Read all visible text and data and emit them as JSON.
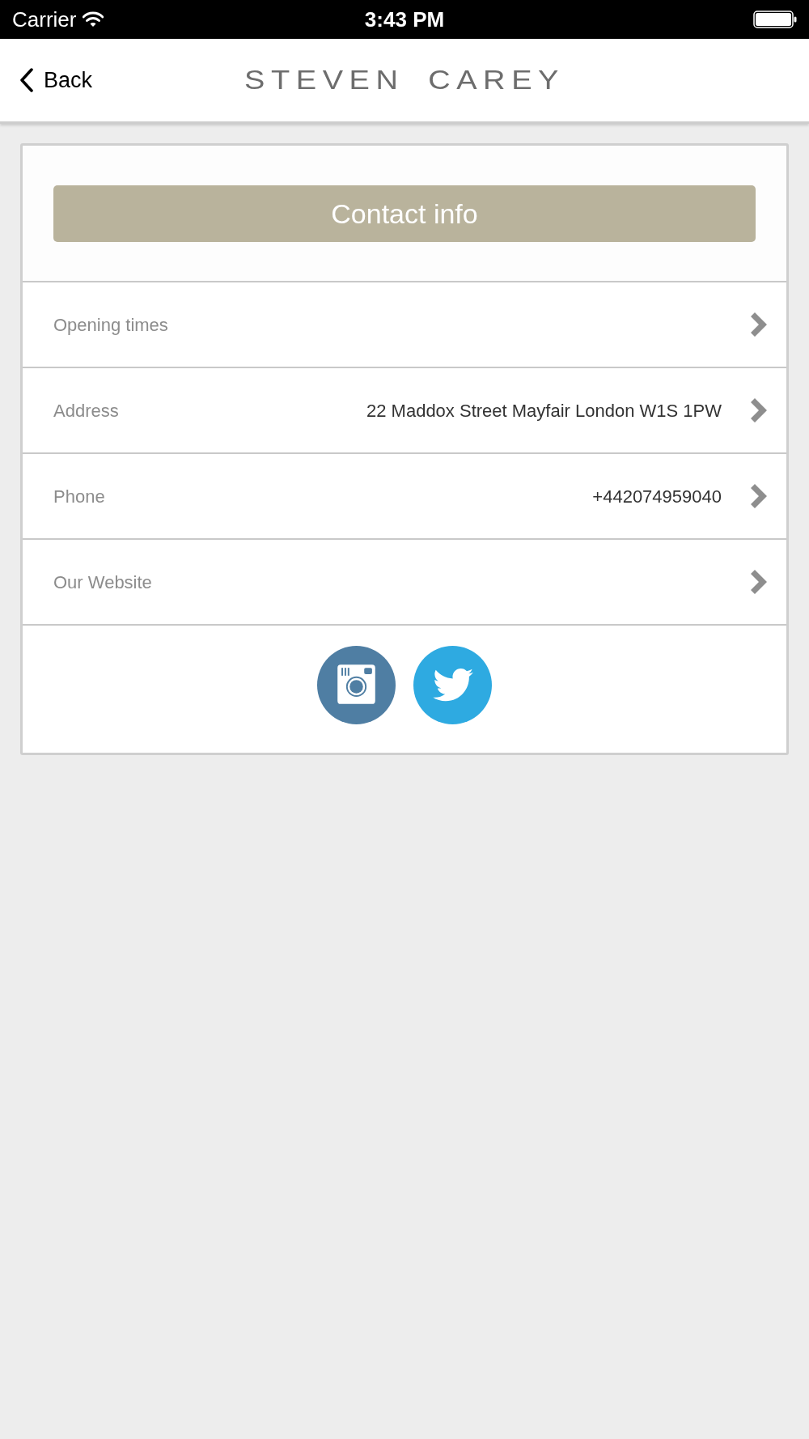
{
  "status_bar": {
    "carrier": "Carrier",
    "time": "3:43 PM"
  },
  "nav_bar": {
    "back_label": "Back",
    "logo": "STEVEN CAREY"
  },
  "card": {
    "header_button": "Contact info",
    "rows": [
      {
        "label": "Opening times"
      },
      {
        "label": "Address",
        "value": "22 Maddox Street Mayfair London W1S 1PW"
      },
      {
        "label": "Phone",
        "value": "+442074959040"
      },
      {
        "label": "Our Website"
      }
    ],
    "social": [
      {
        "kind": "instagram",
        "color": "#4f7ea3"
      },
      {
        "kind": "twitter",
        "color": "#2eaae1"
      }
    ]
  }
}
